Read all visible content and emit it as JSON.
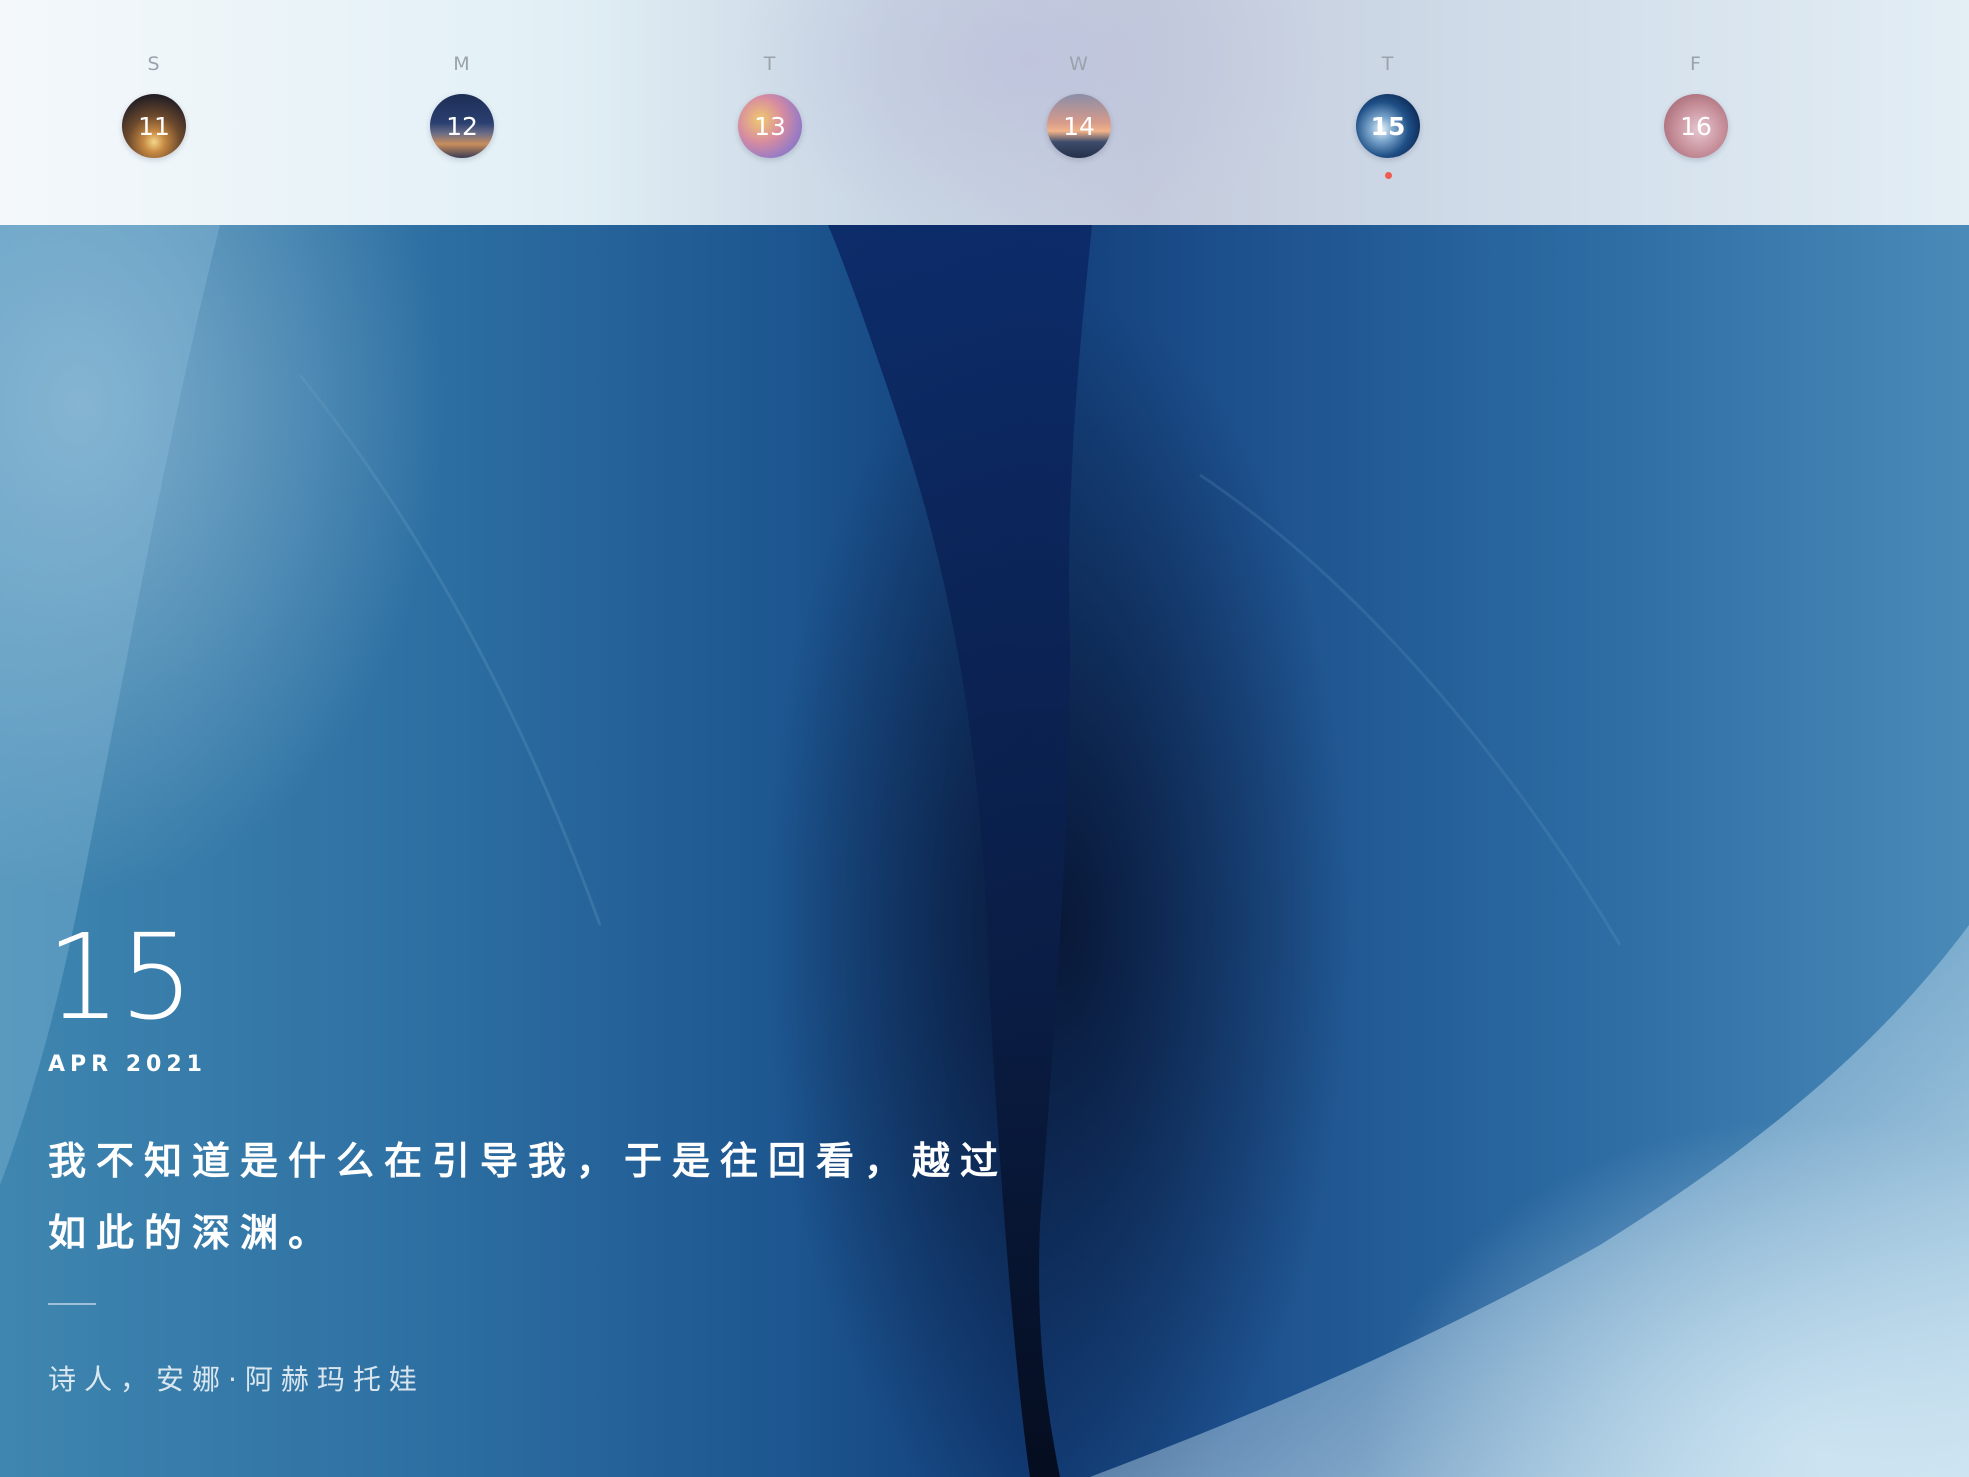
{
  "week": [
    {
      "letter": "S",
      "day": "11"
    },
    {
      "letter": "M",
      "day": "12"
    },
    {
      "letter": "T",
      "day": "13"
    },
    {
      "letter": "W",
      "day": "14"
    },
    {
      "letter": "T",
      "day": "15"
    },
    {
      "letter": "F",
      "day": "16"
    }
  ],
  "selected_day": "15",
  "colors": {
    "today_dot": "#ef5b50",
    "text": "#ffffff"
  },
  "entry": {
    "day_number": "15",
    "month_year": "APR 2021",
    "quote_line1": "我不知道是什么在引导我，于是往回看，越过",
    "quote_line2": "如此的深渊。",
    "author": "诗人，安娜·阿赫玛托娃"
  }
}
